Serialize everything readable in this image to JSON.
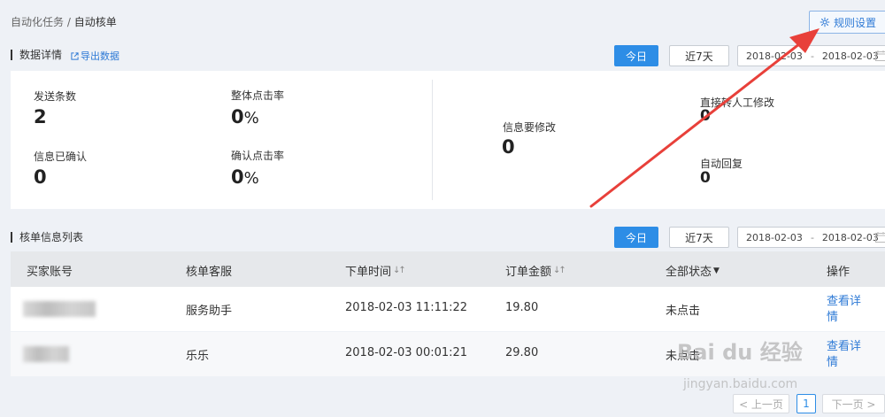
{
  "breadcrumb": {
    "parent": "自动化任务",
    "separator": " / ",
    "current": "自动核单"
  },
  "header": {
    "rule_settings_label": "规则设置",
    "rule_settings_icon": "gear-icon"
  },
  "data_section": {
    "title": "数据详情",
    "export_label": "导出数据",
    "export_icon": "external-link-icon",
    "today_label": "今日",
    "last7_label": "近7天",
    "date_start": "2018-02-03",
    "date_end": "2018-02-03",
    "date_separator": "-"
  },
  "stats": {
    "sent_count_label": "发送条数",
    "sent_count_value": "2",
    "overall_click_rate_label": "整体点击率",
    "overall_click_rate_value": "0",
    "overall_click_rate_unit": "%",
    "info_confirmed_label": "信息已确认",
    "info_confirmed_value": "0",
    "confirm_click_rate_label": "确认点击率",
    "confirm_click_rate_value": "0",
    "confirm_click_rate_unit": "%",
    "info_modify_label": "信息要修改",
    "info_modify_value": "0",
    "direct_manual_label": "直接转人工修改",
    "direct_manual_value": "0",
    "auto_reply_label": "自动回复",
    "auto_reply_value": "0"
  },
  "list_section": {
    "title": "核单信息列表",
    "today_label": "今日",
    "last7_label": "近7天",
    "date_start": "2018-02-03",
    "date_end": "2018-02-03",
    "date_separator": "-"
  },
  "table": {
    "columns": {
      "buyer": "买家账号",
      "service": "核单客服",
      "order_time": "下单时间",
      "amount": "订单金额",
      "status": "全部状态",
      "action": "操作"
    },
    "rows": [
      {
        "service": "服务助手",
        "order_time": "2018-02-03 11:11:22",
        "amount": "19.80",
        "status": "未点击",
        "action": "查看详情"
      },
      {
        "service": "乐乐",
        "order_time": "2018-02-03 00:01:21",
        "amount": "29.80",
        "status": "未点击",
        "action": "查看详情"
      }
    ]
  },
  "pagination": {
    "prev_label": "< 上一页",
    "current_page": "1",
    "next_label": "下一页 >"
  },
  "watermark": {
    "brand": "Bai du 经验",
    "url": "jingyan.baidu.com"
  },
  "colors": {
    "primary": "#2d8de6",
    "link": "#2e7ad6",
    "arrow": "#e8403a",
    "background": "#eef1f6"
  }
}
